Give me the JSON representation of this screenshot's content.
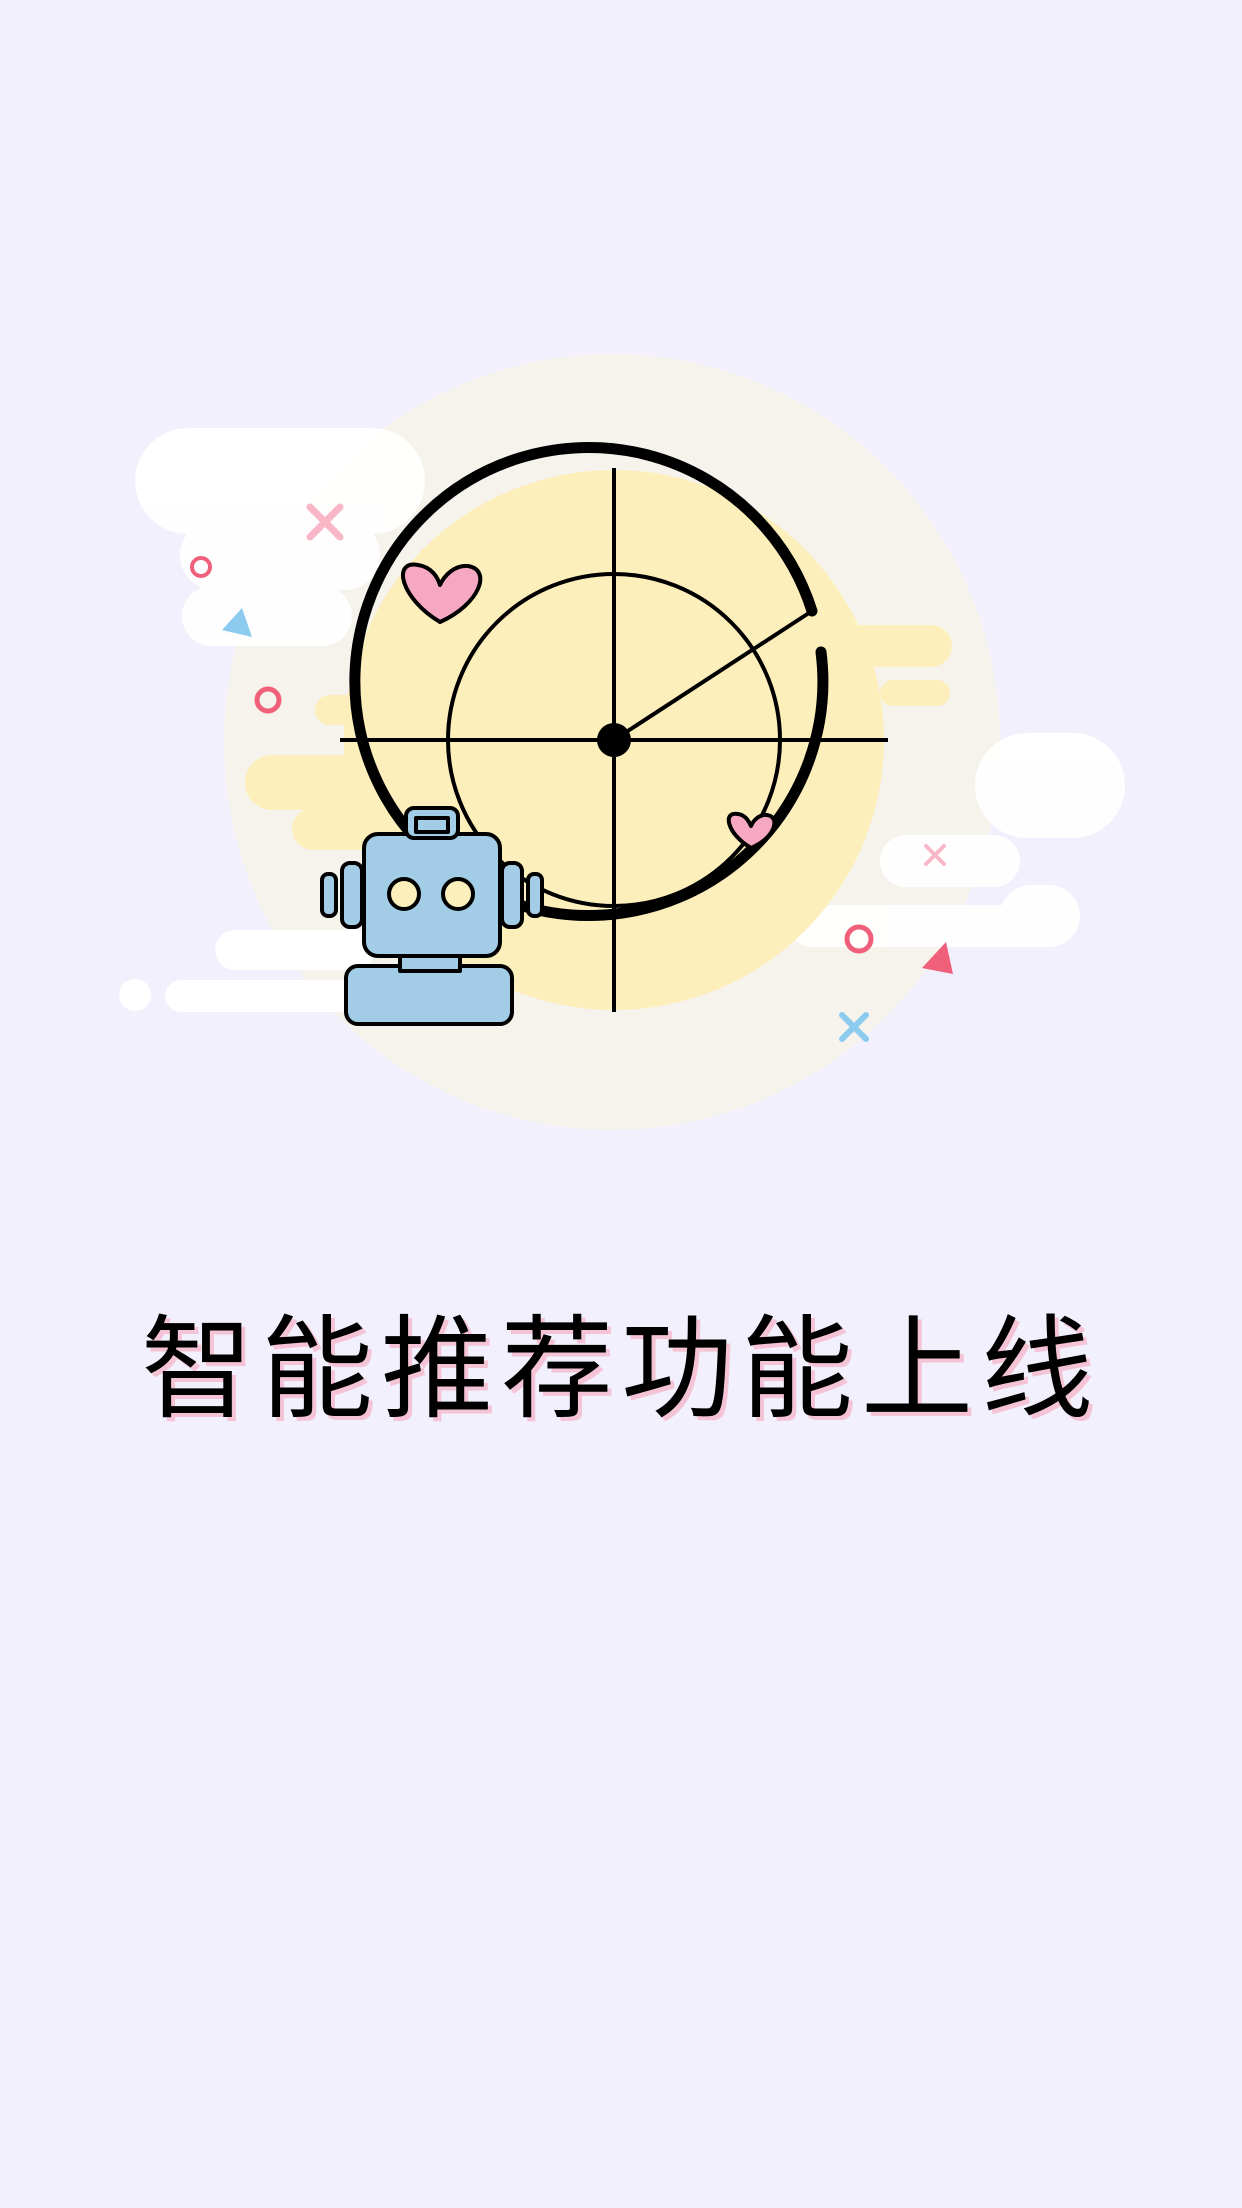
{
  "splash": {
    "headline": "智能推荐功能上线"
  },
  "colors": {
    "background": "#f1f0fc",
    "radar_fill": "#fdefbc",
    "halo": "#f6f3ec",
    "robot_blue": "#a3cde6",
    "heart_pink": "#f6a8c2",
    "accent_red": "#f0607a",
    "accent_blue": "#8ccbef"
  },
  "icons": [
    "radar-icon",
    "robot-icon",
    "heart-icon",
    "cloud-icon",
    "cross-icon",
    "triangle-icon",
    "ring-icon"
  ]
}
